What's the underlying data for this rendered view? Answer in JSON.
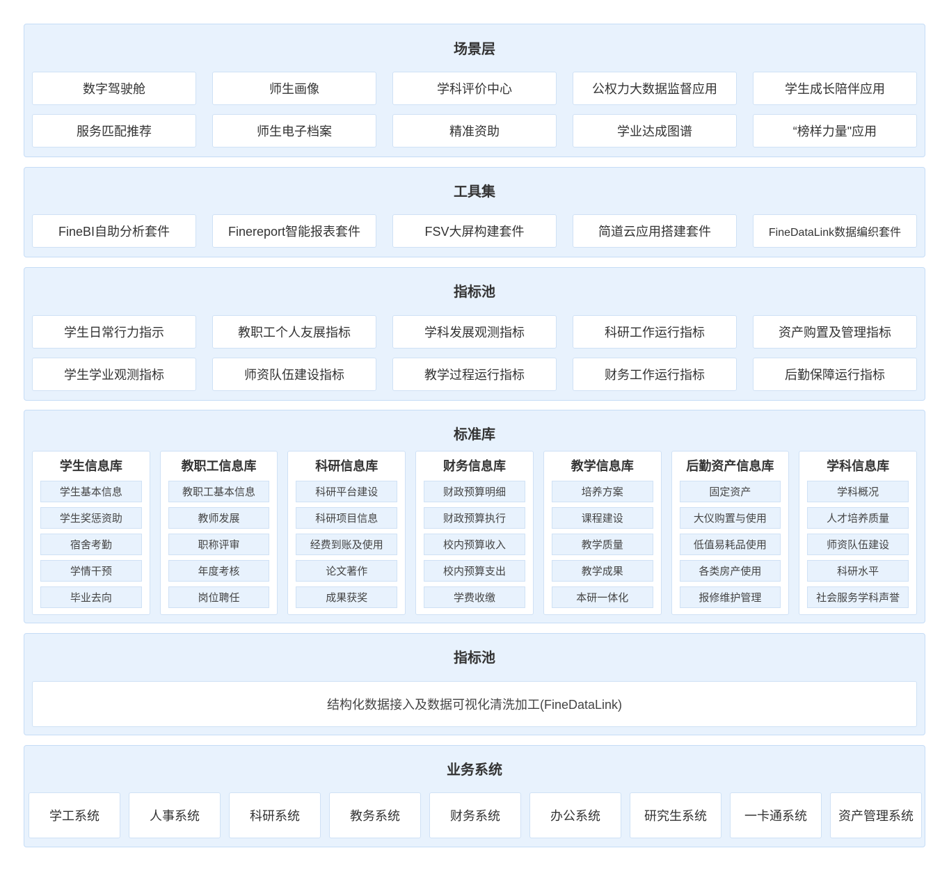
{
  "scene_layer": {
    "title": "场景层",
    "items": [
      "数字驾驶舱",
      "师生画像",
      "学科评价中心",
      "公权力大数据监督应用",
      "学生成长陪伴应用",
      "服务匹配推荐",
      "师生电子档案",
      "精准资助",
      "学业达成图谱",
      "“榜样力量\"应用"
    ]
  },
  "toolset": {
    "title": "工具集",
    "items": [
      "FineBI自助分析套件",
      "Finereport智能报表套件",
      "FSV大屏构建套件",
      "简道云应用搭建套件",
      "FineDataLink数据编织套件"
    ]
  },
  "indicator_pool": {
    "title": "指标池",
    "items": [
      "学生日常行力指示",
      "教职工个人友展指标",
      "学科发展观测指标",
      "科研工作运行指标",
      "资产购置及管理指标",
      "学生学业观测指标",
      "师资队伍建设指标",
      "教学过程运行指标",
      "财务工作运行指标",
      "后勤保障运行指标"
    ]
  },
  "standard_library": {
    "title": "标准库",
    "libs": [
      {
        "title": "学生信息库",
        "items": [
          "学生基本信息",
          "学生奖惩资助",
          "宿舍考勤",
          "学情干预",
          "毕业去向"
        ]
      },
      {
        "title": "教职工信息库",
        "items": [
          "教职工基本信息",
          "教师发展",
          "职称评审",
          "年度考核",
          "岗位聘任"
        ]
      },
      {
        "title": "科研信息库",
        "items": [
          "科研平台建设",
          "科研项目信息",
          "经费到账及使用",
          "论文著作",
          "成果获奖"
        ]
      },
      {
        "title": "财务信息库",
        "items": [
          "财政预算明细",
          "财政预算执行",
          "校内预算收入",
          "校内预算支出",
          "学费收缴"
        ]
      },
      {
        "title": "教学信息库",
        "items": [
          "培养方案",
          "课程建设",
          "教学质量",
          "教学成果",
          "本研一体化"
        ]
      },
      {
        "title": "后勤资产信息库",
        "items": [
          "固定资产",
          "大仪购置与使用",
          "低值易耗品使用",
          "各类房产使用",
          "报修维护管理"
        ]
      },
      {
        "title": "学科信息库",
        "items": [
          "学科概况",
          "人才培养质量",
          "师资队伍建设",
          "科研水平",
          "社会服务学科声誉"
        ]
      }
    ]
  },
  "data_layer": {
    "title": "指标池",
    "content": "结构化数据接入及数据可视化清洗加工(FineDataLink)"
  },
  "business_systems": {
    "title": "业务系统",
    "items": [
      "学工系统",
      "人事系统",
      "科研系统",
      "教务系统",
      "财务系统",
      "办公系统",
      "研究生系统",
      "一卡通系统",
      "资产管理系统"
    ]
  }
}
